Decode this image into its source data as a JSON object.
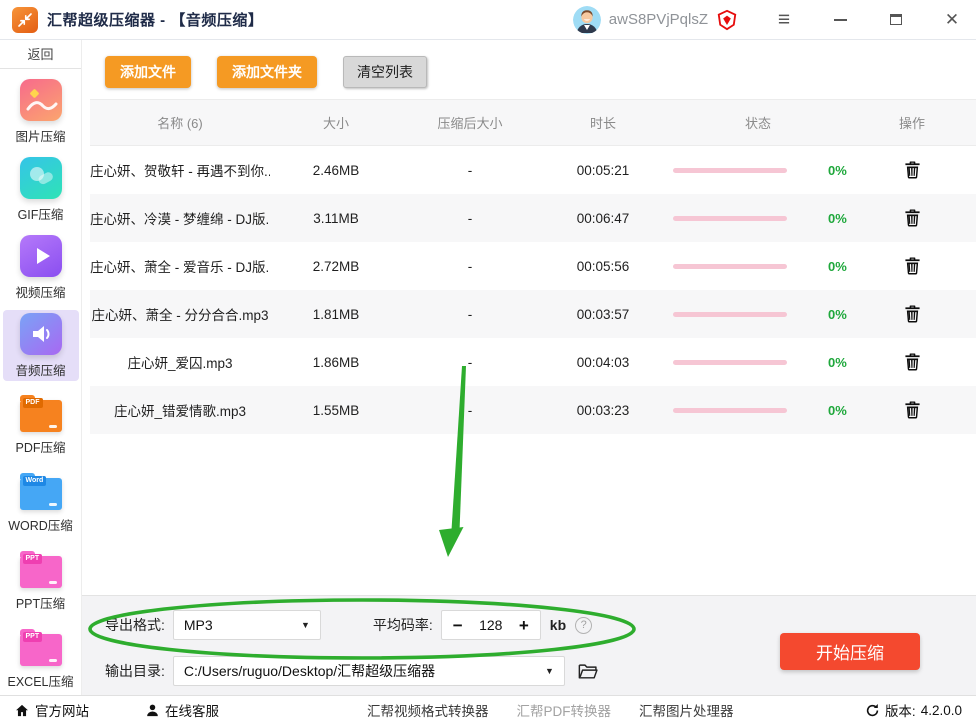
{
  "titlebar": {
    "title": "汇帮超级压缩器 - 【音频压缩】",
    "username": "awS8PVjPqlsZ"
  },
  "icons": {
    "menu": "≡",
    "close": "✕",
    "caret": "▼",
    "question": "?"
  },
  "sidebar": {
    "back": "返回",
    "items": [
      {
        "label": "图片压缩"
      },
      {
        "label": "GIF压缩"
      },
      {
        "label": "视频压缩"
      },
      {
        "label": "音频压缩"
      },
      {
        "label": "PDF压缩",
        "tag": "PDF"
      },
      {
        "label": "WORD压缩",
        "tag": "Word"
      },
      {
        "label": "PPT压缩",
        "tag": "PPT"
      },
      {
        "label": "EXCEL压缩",
        "tag": "PPT"
      }
    ]
  },
  "toolbar": {
    "add_file": "添加文件",
    "add_folder": "添加文件夹",
    "clear_list": "清空列表"
  },
  "table": {
    "headers": {
      "name": "名称 (6)",
      "size": "大小",
      "compressed": "压缩后大小",
      "duration": "时长",
      "status": "状态",
      "action": "操作"
    },
    "rows": [
      {
        "name": "庄心妍、贺敬轩 - 再遇不到你...",
        "size": "2.46MB",
        "compressed": "-",
        "duration": "00:05:21",
        "percent": "0%"
      },
      {
        "name": "庄心妍、冷漠 - 梦缠绵 - DJ版....",
        "size": "3.11MB",
        "compressed": "-",
        "duration": "00:06:47",
        "percent": "0%"
      },
      {
        "name": "庄心妍、萧全 - 爱音乐 - DJ版....",
        "size": "2.72MB",
        "compressed": "-",
        "duration": "00:05:56",
        "percent": "0%"
      },
      {
        "name": "庄心妍、萧全 - 分分合合.mp3",
        "size": "1.81MB",
        "compressed": "-",
        "duration": "00:03:57",
        "percent": "0%"
      },
      {
        "name": "庄心妍_爱囚.mp3",
        "size": "1.86MB",
        "compressed": "-",
        "duration": "00:04:03",
        "percent": "0%"
      },
      {
        "name": "庄心妍_错爱情歌.mp3",
        "size": "1.55MB",
        "compressed": "-",
        "duration": "00:03:23",
        "percent": "0%"
      }
    ]
  },
  "settings": {
    "export_format_label": "导出格式:",
    "export_format_value": "MP3",
    "bitrate_label": "平均码率:",
    "minus": "−",
    "bitrate_value": "128",
    "plus": "+",
    "unit": "kb",
    "output_dir_label": "输出目录:",
    "output_dir_value": "C:/Users/ruguo/Desktop/汇帮超级压缩器",
    "start_label": "开始压缩"
  },
  "statusbar": {
    "official": "官方网站",
    "support": "在线客服",
    "video": "汇帮视频格式转换器",
    "pdf": "汇帮PDF转换器",
    "image": "汇帮图片处理器",
    "version_label": "版本:",
    "version_value": "4.2.0.0"
  },
  "colors": {
    "accent_orange": "#f59a23",
    "start_red": "#f4492f",
    "progress_pink": "#f6c6d4",
    "percent_green": "#1fa83c",
    "annotation_green": "#2ead2e",
    "selected_purple": "#e5def8"
  }
}
